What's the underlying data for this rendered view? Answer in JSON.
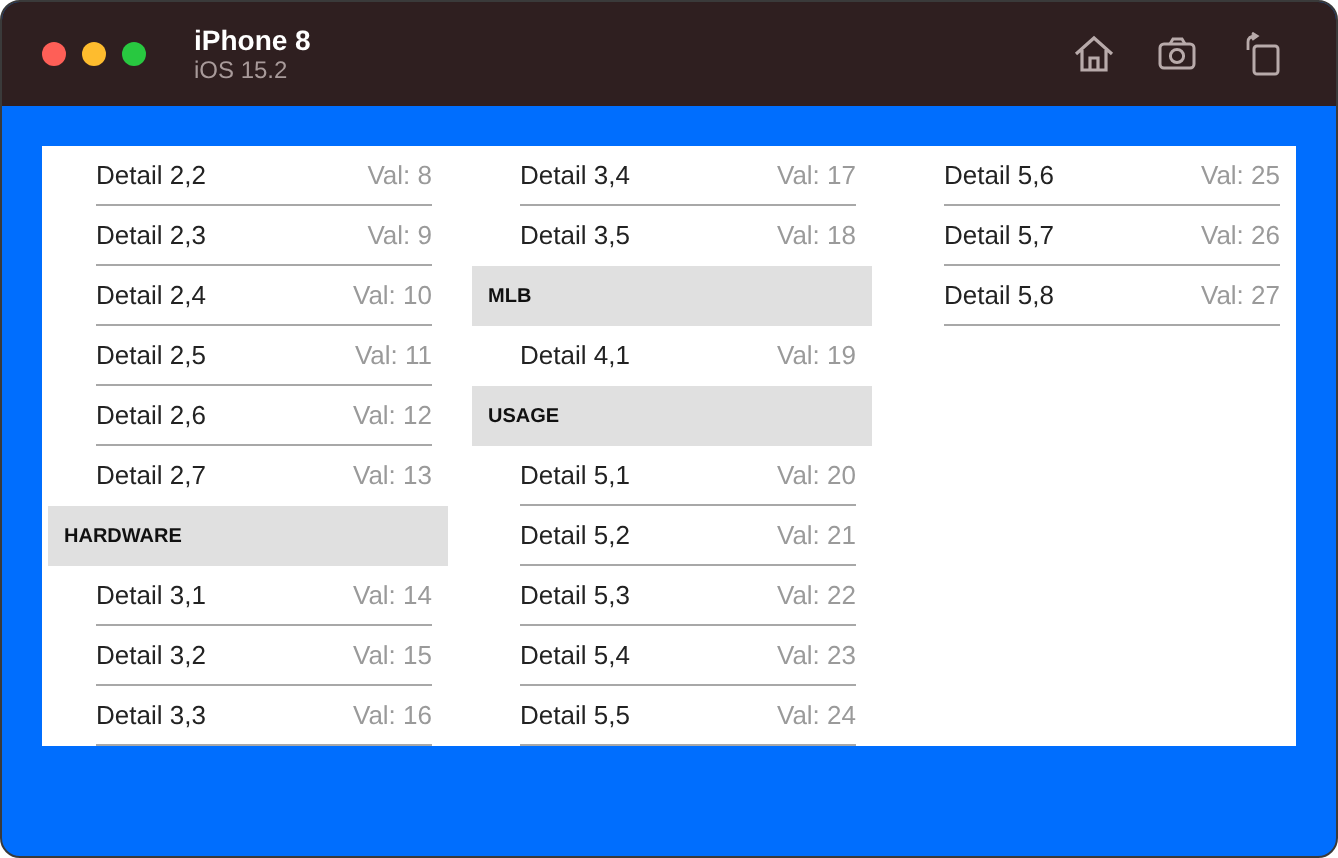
{
  "window": {
    "title": "iPhone 8",
    "subtitle": "iOS 15.2"
  },
  "columns": [
    {
      "items": [
        {
          "kind": "row",
          "label": "Detail 2,2",
          "value": "Val: 8"
        },
        {
          "kind": "row",
          "label": "Detail 2,3",
          "value": "Val: 9"
        },
        {
          "kind": "row",
          "label": "Detail 2,4",
          "value": "Val: 10"
        },
        {
          "kind": "row",
          "label": "Detail 2,5",
          "value": "Val: 11"
        },
        {
          "kind": "row",
          "label": "Detail 2,6",
          "value": "Val: 12"
        },
        {
          "kind": "row",
          "label": "Detail 2,7",
          "value": "Val: 13"
        },
        {
          "kind": "header",
          "label": "HARDWARE"
        },
        {
          "kind": "row",
          "label": "Detail 3,1",
          "value": "Val: 14"
        },
        {
          "kind": "row",
          "label": "Detail 3,2",
          "value": "Val: 15"
        },
        {
          "kind": "row",
          "label": "Detail 3,3",
          "value": "Val: 16"
        }
      ]
    },
    {
      "items": [
        {
          "kind": "row",
          "label": "Detail 3,4",
          "value": "Val: 17"
        },
        {
          "kind": "row",
          "label": "Detail 3,5",
          "value": "Val: 18"
        },
        {
          "kind": "header",
          "label": "MLB"
        },
        {
          "kind": "row",
          "label": "Detail 4,1",
          "value": "Val: 19"
        },
        {
          "kind": "header",
          "label": "USAGE"
        },
        {
          "kind": "row",
          "label": "Detail 5,1",
          "value": "Val: 20"
        },
        {
          "kind": "row",
          "label": "Detail 5,2",
          "value": "Val: 21"
        },
        {
          "kind": "row",
          "label": "Detail 5,3",
          "value": "Val: 22"
        },
        {
          "kind": "row",
          "label": "Detail 5,4",
          "value": "Val: 23"
        },
        {
          "kind": "row",
          "label": "Detail 5,5",
          "value": "Val: 24"
        }
      ]
    },
    {
      "items": [
        {
          "kind": "row",
          "label": "Detail 5,6",
          "value": "Val: 25"
        },
        {
          "kind": "row",
          "label": "Detail 5,7",
          "value": "Val: 26"
        },
        {
          "kind": "row",
          "label": "Detail 5,8",
          "value": "Val: 27"
        }
      ]
    }
  ]
}
